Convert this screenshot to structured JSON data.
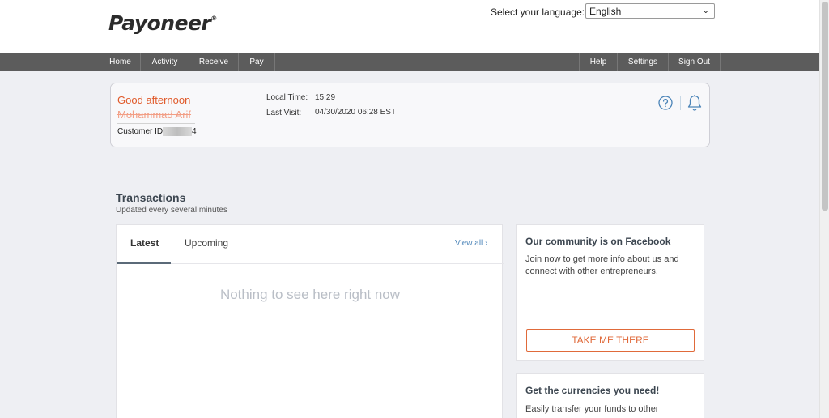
{
  "header": {
    "logo_text": "Payoneer",
    "logo_mark": "®",
    "language_label": "Select your language:",
    "language_value": "English"
  },
  "nav": {
    "left": [
      "Home",
      "Activity",
      "Receive",
      "Pay"
    ],
    "right": [
      "Help",
      "Settings",
      "Sign Out"
    ]
  },
  "welcome": {
    "greeting": "Good afternoon",
    "name": "Mohammad Arif",
    "customer_id_label": "Customer ID",
    "customer_id_suffix": "4",
    "local_time_label": "Local Time:",
    "local_time": "15:29",
    "last_visit_label": "Last Visit:",
    "last_visit": "04/30/2020 06:28 EST"
  },
  "transactions": {
    "title": "Transactions",
    "subtitle": "Updated every several minutes",
    "tabs": [
      "Latest",
      "Upcoming"
    ],
    "view_all": "View all",
    "empty": "Nothing to see here right now"
  },
  "cards": [
    {
      "title": "Our community is on Facebook",
      "text": "Join now to get more info about us and connect with other entrepreneurs.",
      "button": "TAKE ME THERE"
    },
    {
      "title": "Get the currencies you need!",
      "text": "Easily transfer your funds to other"
    }
  ],
  "colors": {
    "brand_orange": "#e05a2a",
    "nav_bg": "#5c5c5c",
    "link_blue": "#4b84b8"
  }
}
